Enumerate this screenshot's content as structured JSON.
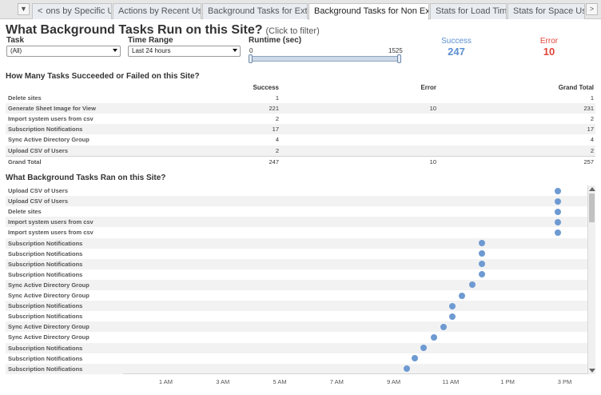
{
  "tabs": {
    "overflow_btn": "▼",
    "prev_btn": "<",
    "next_btn": ">",
    "items": [
      {
        "label": "ons by Specific User",
        "active": false
      },
      {
        "label": "Actions by Recent Users",
        "active": false
      },
      {
        "label": "Background Tasks for Extracts",
        "active": false
      },
      {
        "label": "Background Tasks for Non Extracts",
        "active": true
      },
      {
        "label": "Stats for Load Times",
        "active": false
      },
      {
        "label": "Stats for Space Usage",
        "active": false
      }
    ]
  },
  "header": {
    "title": "What Background Tasks Run on this Site?",
    "hint": "(Click to filter)"
  },
  "filters": {
    "task_label": "Task",
    "task_value": "(All)",
    "time_label": "Time Range",
    "time_value": "Last 24 hours",
    "runtime_label": "Runtime (sec)",
    "runtime_min": "0",
    "runtime_max": "1525"
  },
  "kpis": {
    "success_label": "Success",
    "success_value": "247",
    "error_label": "Error",
    "error_value": "10",
    "success_color": "#5b8fd0",
    "error_color": "#e0453a"
  },
  "crosstab": {
    "title": "How Many Tasks Succeeded or Failed on this Site?",
    "columns": [
      "Success",
      "Error",
      "Grand Total"
    ],
    "rows": [
      {
        "name": "Delete sites",
        "success": "1",
        "error": "",
        "total": "1"
      },
      {
        "name": "Generate Sheet Image for View",
        "success": "221",
        "error": "10",
        "total": "231"
      },
      {
        "name": "Import system users from csv",
        "success": "2",
        "error": "",
        "total": "2"
      },
      {
        "name": "Subscription Notifications",
        "success": "17",
        "error": "",
        "total": "17"
      },
      {
        "name": "Sync Active Directory Group",
        "success": "4",
        "error": "",
        "total": "4"
      },
      {
        "name": "Upload CSV of Users",
        "success": "2",
        "error": "",
        "total": "2"
      }
    ],
    "grand_total": {
      "name": "Grand Total",
      "success": "247",
      "error": "10",
      "total": "257"
    }
  },
  "chart_data": {
    "type": "scatter",
    "title": "What Background Tasks Ran on this Site?",
    "xlabel": "",
    "ylabel": "",
    "x_ticks": [
      "1 AM",
      "3 AM",
      "5 AM",
      "7 AM",
      "9 AM",
      "11 AM",
      "1 PM",
      "3 PM"
    ],
    "x_range_hours": [
      -0.5,
      15.8
    ],
    "dot_color": "#6e9ad2",
    "categories": [
      "Upload CSV of Users",
      "Upload CSV of Users",
      "Delete sites",
      "Import system users from csv",
      "Import system users from csv",
      "Subscription Notifications",
      "Subscription Notifications",
      "Subscription Notifications",
      "Subscription Notifications",
      "Sync Active Directory Group",
      "Sync Active Directory Group",
      "Subscription Notifications",
      "Subscription Notifications",
      "Sync Active Directory Group",
      "Sync Active Directory Group",
      "Subscription Notifications",
      "Subscription Notifications",
      "Subscription Notifications"
    ],
    "values_hour": [
      14.75,
      14.75,
      14.75,
      14.75,
      14.75,
      12.1,
      12.1,
      12.1,
      12.1,
      11.75,
      11.4,
      11.05,
      11.05,
      10.75,
      10.4,
      10.05,
      9.75,
      9.45
    ]
  }
}
